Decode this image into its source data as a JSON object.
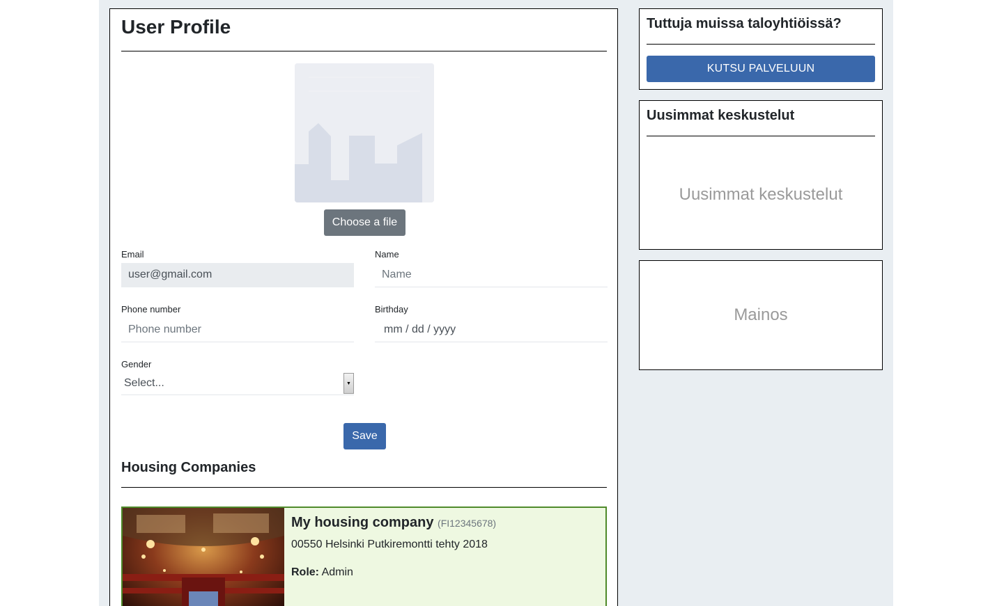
{
  "profile": {
    "title": "User Profile",
    "choose_file_label": "Choose a file",
    "email": {
      "label": "Email",
      "value": "user@gmail.com"
    },
    "name": {
      "label": "Name",
      "placeholder": "Name"
    },
    "phone": {
      "label": "Phone number",
      "placeholder": "Phone number"
    },
    "birthday": {
      "label": "Birthday",
      "placeholder": "mm / dd / yyyy"
    },
    "gender": {
      "label": "Gender",
      "selected": "Select..."
    },
    "save_label": "Save"
  },
  "housing": {
    "title": "Housing Companies",
    "companies": [
      {
        "name": "My housing company",
        "id": "(FI12345678)",
        "address": "00550 Helsinki Putkiremontti tehty 2018",
        "role_label": "Role:",
        "role": "Admin"
      }
    ]
  },
  "sidebar": {
    "invite": {
      "title": "Tuttuja muissa taloyhtiöissä?",
      "button_label": "KUTSU PALVELUUN"
    },
    "discussions": {
      "title": "Uusimmat keskustelut",
      "placeholder": "Uusimmat keskustelut"
    },
    "ad": {
      "placeholder": "Mainos"
    }
  },
  "colors": {
    "primary": "#3a68ab",
    "secondary_button": "#6c757d",
    "page_background": "#e9eef2",
    "company_card_background": "#eef8e1",
    "company_card_border": "#4e8a2a"
  },
  "icons": {
    "avatar": "building-placeholder-icon",
    "select_arrow": "dropdown-arrow-icon"
  }
}
